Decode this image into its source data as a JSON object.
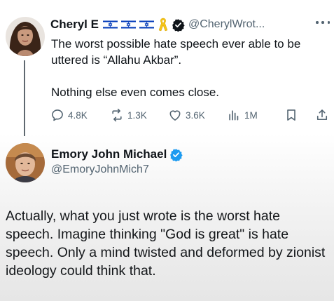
{
  "original_tweet": {
    "author": {
      "display_name": "Cheryl E",
      "handle": "@CherylWrot...",
      "badges": [
        "israel-flag-icon",
        "israel-flag-icon",
        "israel-flag-icon",
        "yellow-ribbon-icon",
        "verified-badge-icon"
      ]
    },
    "text_lines": [
      "The worst possible hate speech ever able to be uttered is “Allahu Akbar”.",
      "Nothing else even comes close."
    ],
    "actions": {
      "replies": "4.8K",
      "reposts": "1.3K",
      "likes": "3.6K",
      "views": "1M"
    }
  },
  "reply": {
    "author": {
      "display_name": "Emory John Michael",
      "handle": "@EmoryJohnMich7",
      "badges": [
        "verified-badge-icon"
      ]
    },
    "text": "Actually, what you just wrote is the worst hate speech. Imagine thinking \"God is great\" is hate speech. Only a mind twisted and deformed by zionist ideology could think that."
  },
  "colors": {
    "text_primary": "#0f1419",
    "text_secondary": "#536471",
    "verified_blue": "#1d9bf0",
    "thread_line": "#5f6870",
    "flag_blue": "#0038b8"
  }
}
